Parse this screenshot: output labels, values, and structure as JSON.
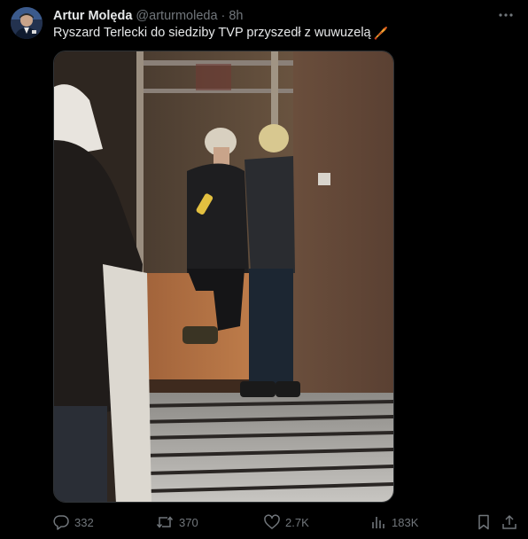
{
  "author": {
    "display_name": "Artur Molęda",
    "handle": "@arturmoleda",
    "separator": "·",
    "time": "8h"
  },
  "tweet": {
    "text": "Ryszard Terlecki do siedziby TVP przyszedł z wuwuzelą",
    "trailing_emoji": "vuvuzela-emoji"
  },
  "actions": {
    "replies": "332",
    "reposts": "370",
    "likes": "2.7K",
    "views": "183K"
  },
  "icons": {
    "more": "more-icon",
    "reply": "reply-icon",
    "repost": "repost-icon",
    "like": "like-icon",
    "views": "views-icon",
    "bookmark": "bookmark-icon",
    "share": "share-icon"
  },
  "colors": {
    "background": "#000000",
    "text_primary": "#e7e9ea",
    "text_secondary": "#71767b",
    "border": "#2f3336"
  }
}
